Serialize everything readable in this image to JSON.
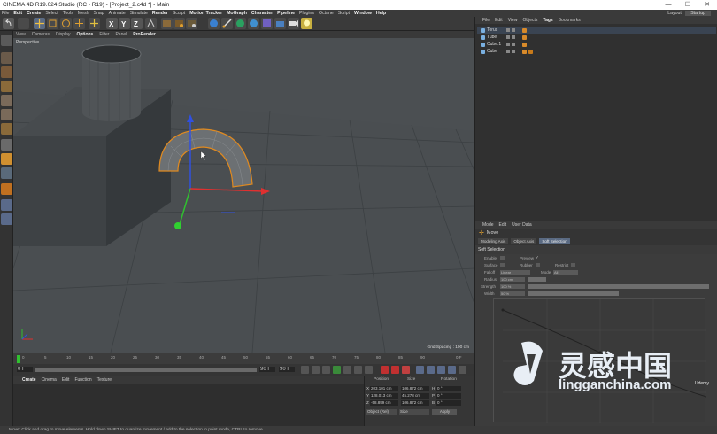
{
  "window": {
    "title": "CINEMA 4D R19.024 Studio (RC - R19) - [Project_2.c4d *] - Main",
    "controls": [
      "—",
      "☐",
      "✕"
    ]
  },
  "menubar": {
    "items": [
      "File",
      "Edit",
      "Create",
      "Select",
      "Tools",
      "Mesh",
      "Snap",
      "Animate",
      "Simulate",
      "Render",
      "Sculpt",
      "Motion Tracker",
      "MoGraph",
      "Character",
      "Pipeline",
      "Plugins",
      "Octane",
      "Script",
      "Window",
      "Help"
    ],
    "layout_label": "Layout:",
    "layout_value": "Startup"
  },
  "viewport": {
    "menu": [
      "View",
      "Cameras",
      "Display",
      "Options",
      "Filter",
      "Panel",
      "ProRender"
    ],
    "active_menu": "Options",
    "label": "Perspective",
    "grid_spacing": "Grid Spacing : 100 cm"
  },
  "timeline": {
    "ticks": [
      "0",
      "5",
      "10",
      "15",
      "20",
      "25",
      "30",
      "35",
      "40",
      "45",
      "50",
      "55",
      "60",
      "65",
      "70",
      "75",
      "80",
      "85",
      "90"
    ],
    "end_label": "0 F",
    "start_field": "0 F",
    "current_field": "0 F",
    "end_field": "90 F",
    "max_field": "90 F"
  },
  "material_manager": {
    "menu": [
      "Create",
      "Cinema",
      "Edit",
      "Function",
      "Texture"
    ]
  },
  "coordinates": {
    "headers": [
      "Position",
      "Size",
      "Rotation"
    ],
    "rows": [
      {
        "pos": "203.101 cm",
        "axis": "X",
        "size": "106.872 cm",
        "rot_axis": "H",
        "rot": "0 °"
      },
      {
        "pos": "128.013 cm",
        "axis": "Y",
        "size": "45.278 cm",
        "rot_axis": "P",
        "rot": "0 °"
      },
      {
        "pos": "-58.899 cm",
        "axis": "Z",
        "size": "106.872 cm",
        "rot_axis": "B",
        "rot": "0 °"
      }
    ],
    "mode": "Object (Rel)",
    "size_mode": "Size",
    "apply": "Apply"
  },
  "object_manager": {
    "menu": [
      "File",
      "Edit",
      "View",
      "Objects",
      "Tags",
      "Bookmarks"
    ],
    "active_menu": "Tags",
    "objects": [
      {
        "name": "Torus",
        "icon_color": "#7ab0e0"
      },
      {
        "name": "Tube",
        "icon_color": "#7ab0e0"
      },
      {
        "name": "Cube.1",
        "icon_color": "#7ab0e0"
      },
      {
        "name": "Cube",
        "icon_color": "#7ab0e0"
      }
    ]
  },
  "attribute_manager": {
    "menu": [
      "Mode",
      "Edit",
      "User Data"
    ],
    "title": "Move",
    "tabs": [
      "Modeling Axis",
      "Object Axis",
      "Soft Selection"
    ],
    "active_tab": "Soft Selection",
    "section": "Soft Selection",
    "fields": {
      "enable": "Enable",
      "preview": "Preview",
      "surface": "Surface",
      "rubber": "Rubber",
      "restrict": "Restrict",
      "falloff": "Falloff",
      "falloff_value": "Linear",
      "mode": "Mode",
      "mode_value": "All",
      "radius": "Radius",
      "radius_value": "100 cm",
      "strength": "Strength",
      "strength_value": "100 %",
      "width": "Width",
      "width_value": "50 %"
    }
  },
  "status": {
    "text": "Move: Click and drag to move elements. Hold down SHIFT to quantize movement / add to the selection in point mode, CTRL to remove."
  },
  "watermark": {
    "cn": "灵感中国",
    "url": "lingganchina.com",
    "udemy": "Udemy"
  },
  "colors": {
    "accent_orange": "#e08a20",
    "axis_x": "#e03030",
    "axis_y": "#30c030",
    "axis_z": "#3050e0",
    "selection_tab": "#5a6a82"
  }
}
